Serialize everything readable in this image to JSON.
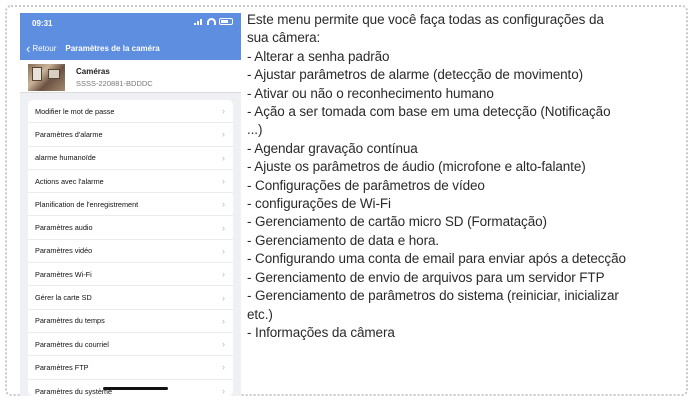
{
  "phone": {
    "status_time": "09:31",
    "nav": {
      "back_label": "Retour",
      "title": "Paramètres de la caméra"
    },
    "camera": {
      "name": "Caméras",
      "id": "SSSS-220881-BDDDC"
    },
    "menu_items": [
      {
        "label": "Modifier le mot de passe"
      },
      {
        "label": "Paramètres d'alarme"
      },
      {
        "label": "alarme humanoïde"
      },
      {
        "label": "Actions  avec l'alarme"
      },
      {
        "label": "Planification de l'enregistrement"
      },
      {
        "label": "Paramètres audio"
      },
      {
        "label": "Paramètres vidéo"
      },
      {
        "label": "Paramètres Wi-Fi"
      },
      {
        "label": "Gérer la carte SD"
      },
      {
        "label": "Paramètres du temps"
      },
      {
        "label": "Paramètres du courriel"
      },
      {
        "label": "Paramètres FTP"
      },
      {
        "label": "Paramètres du système"
      }
    ]
  },
  "description": {
    "lines": [
      "Este menu permite que você faça todas as configurações da",
      "sua câmera:",
      "- Alterar a senha padrão",
      "- Ajustar parâmetros de alarme (detecção de movimento)",
      "- Ativar ou não o reconhecimento humano",
      "- Ação a ser tomada com base em uma detecção (Notificação",
      "...)",
      "- Agendar gravação contínua",
      "- Ajuste os parâmetros de áudio (microfone e alto-falante)",
      "- Configurações de parâmetros de vídeo",
      "- configurações de Wi-Fi",
      "- Gerenciamento de cartão micro SD (Formatação)",
      "- Gerenciamento de data e hora.",
      "- Configurando uma conta de email para enviar após a detecção",
      "- Gerenciamento de envio de arquivos para um servidor FTP",
      "- Gerenciamento de parâmetros do sistema (reiniciar, inicializar",
      "etc.)",
      "- Informações da câmera"
    ]
  },
  "colors": {
    "header_blue": "#5e8ee0",
    "screen_bg": "#eff0f4"
  }
}
